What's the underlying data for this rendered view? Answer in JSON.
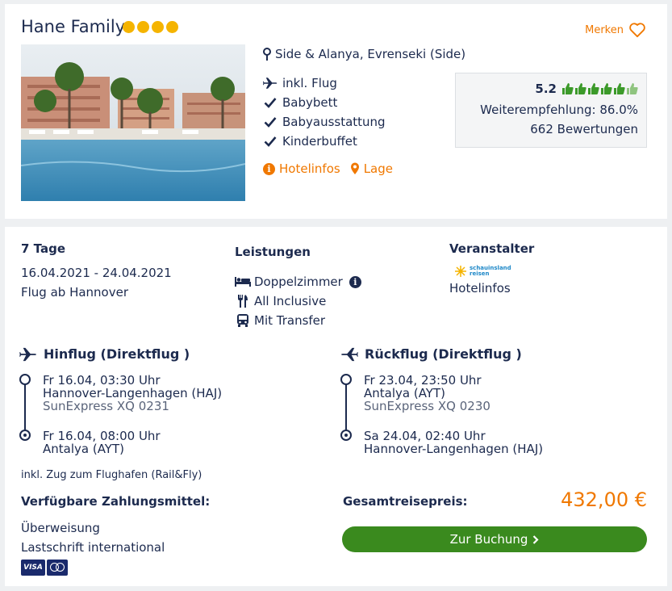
{
  "hotel": {
    "name": "Hane Family",
    "stars": 4,
    "merken_label": "Merken",
    "location": "Side & Alanya, Evrenseki (Side)",
    "features": [
      {
        "icon": "plane-icon",
        "label": "inkl. Flug"
      },
      {
        "icon": "check-icon",
        "label": "Babybett"
      },
      {
        "icon": "check-icon",
        "label": "Babyausstattung"
      },
      {
        "icon": "check-icon",
        "label": "Kinderbuffet"
      }
    ],
    "links": {
      "hotelinfos": "Hotelinfos",
      "lage": "Lage"
    },
    "rating": {
      "score": "5.2",
      "thumbs_total": 6,
      "thumbs_filled": 5,
      "recommendation": "Weiterempfehlung: 86.0%",
      "reviews": "662 Bewertungen"
    }
  },
  "trip": {
    "days": "7 Tage",
    "dates": "16.04.2021 - 24.04.2021",
    "departure": "Flug ab Hannover",
    "leistungen_title": "Leistungen",
    "leistungen": [
      {
        "icon": "bed-icon",
        "label": "Doppelzimmer"
      },
      {
        "icon": "cutlery-icon",
        "label": "All Inclusive"
      },
      {
        "icon": "bus-icon",
        "label": "Mit Transfer"
      }
    ],
    "veranstalter_title": "Veranstalter",
    "veranstalter_logo_text": [
      "schauinsland",
      "reisen"
    ],
    "veranstalter_link": "Hotelinfos"
  },
  "flights": {
    "outbound": {
      "title": "Hinflug (Direktflug )",
      "dep_time": "Fr 16.04, 03:30 Uhr",
      "dep_airport": "Hannover-Langenhagen (HAJ)",
      "flight_no": "SunExpress XQ 0231",
      "arr_time": "Fr 16.04, 08:00 Uhr",
      "arr_airport": "Antalya (AYT)"
    },
    "inbound": {
      "title": "Rückflug (Direktflug )",
      "dep_time": "Fr 23.04, 23:50 Uhr",
      "dep_airport": "Antalya (AYT)",
      "flight_no": "SunExpress XQ 0230",
      "arr_time": "Sa 24.04, 02:40 Uhr",
      "arr_airport": "Hannover-Langenhagen (HAJ)"
    },
    "rail_note": "inkl. Zug zum Flughafen (Rail&Fly)"
  },
  "payment": {
    "title": "Verfügbare Zahlungsmittel:",
    "methods": [
      "Überweisung",
      "Lastschrift international"
    ],
    "card_visa": "VISA"
  },
  "price": {
    "label": "Gesamtreisepreis:",
    "value": "432,00 €"
  },
  "cta": {
    "label": "Zur Buchung"
  },
  "colors": {
    "accent": "#f07800",
    "navy": "#1c2a4e",
    "cta": "#3a8a1e",
    "star": "#f5b400",
    "thumb": "#3c9a2a"
  }
}
